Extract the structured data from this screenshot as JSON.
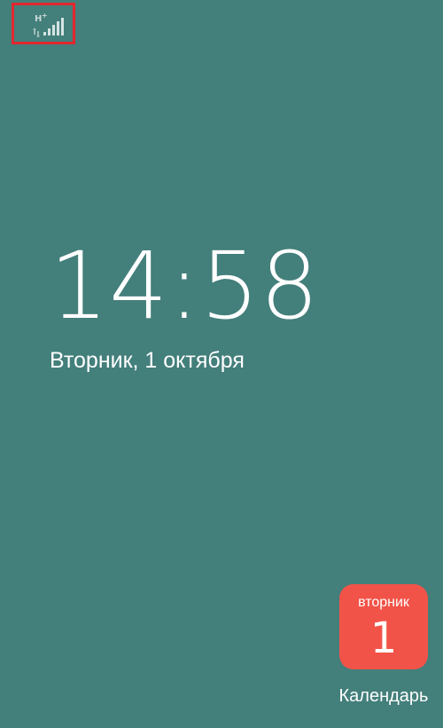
{
  "status_bar": {
    "network_type": "H",
    "network_type_plus": "+",
    "signal_icon": "cellular-signal-icon",
    "highlight_color": "#e3272f"
  },
  "lockscreen": {
    "time": "14:58",
    "date": "Вторник, 1 октября",
    "background_color": "#437f7b"
  },
  "calendar_shortcut": {
    "weekday": "вторник",
    "day": "1",
    "label": "Календарь",
    "color": "#f25348",
    "icon": "calendar-icon"
  }
}
